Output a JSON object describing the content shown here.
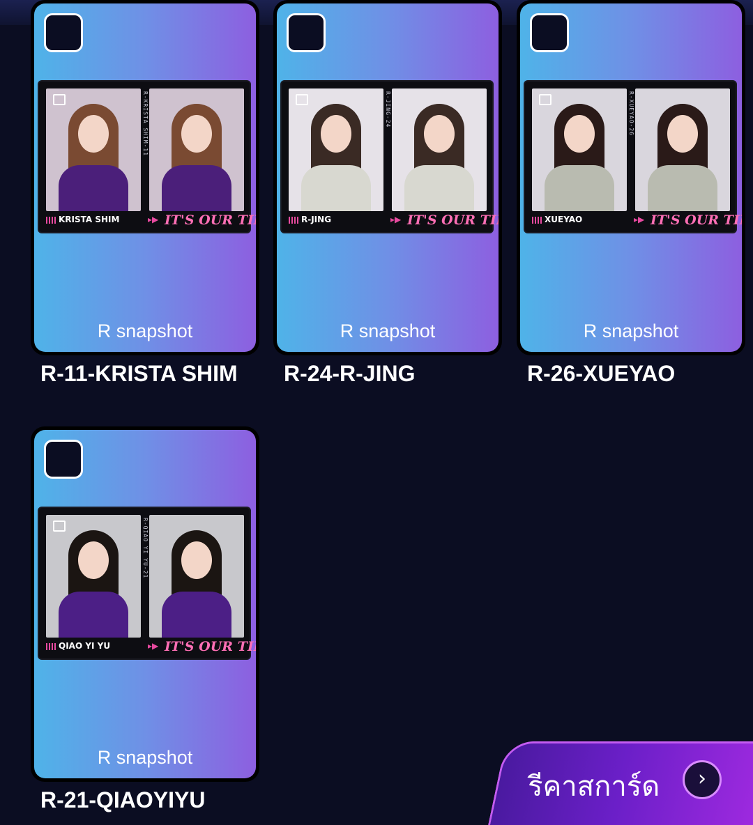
{
  "cards": [
    {
      "rarity_label": "R snapshot",
      "name": "R-11-KRISTA SHIM",
      "member_tag": "KRISTA SHIM",
      "side_code": "R-KRISTA SHIM-11",
      "slogan": "IT'S OUR TIME",
      "palette": {
        "bg": "#cfc2cf",
        "hair": "#7a4a32",
        "body": "#4b1f7a"
      }
    },
    {
      "rarity_label": "R snapshot",
      "name": "R-24-R-JING",
      "member_tag": "R-JING",
      "side_code": "R-JING-24",
      "slogan": "IT'S OUR TIME",
      "palette": {
        "bg": "#e6e2e8",
        "hair": "#3a2a24",
        "body": "#d8d8d0"
      }
    },
    {
      "rarity_label": "R snapshot",
      "name": "R-26-XUEYAO",
      "member_tag": "XUEYAO",
      "side_code": "R-XUEYAO-26",
      "slogan": "IT'S OUR TIME",
      "palette": {
        "bg": "#d9d6dd",
        "hair": "#2a1a18",
        "body": "#b9bbb0"
      }
    },
    {
      "rarity_label": "R snapshot",
      "name": "R-21-QIAOYIYU",
      "member_tag": "QIAO YI YU",
      "side_code": "R-QIAO YI YU-21",
      "slogan": "IT'S OUR TIME",
      "palette": {
        "bg": "#c8c8cc",
        "hair": "#1b1512",
        "body": "#4c1f86"
      }
    }
  ],
  "recast_button": {
    "label": "รีคาสการ์ด",
    "icon": "chevron-right-icon",
    "glyph": "›"
  },
  "colors": {
    "page_bg": "#0b0d22",
    "card_gradient_start": "#4fb3e8",
    "card_gradient_end": "#8d5fe0",
    "slogan_pink": "#ff6fb5",
    "button_purple": "#6b1fc8"
  }
}
